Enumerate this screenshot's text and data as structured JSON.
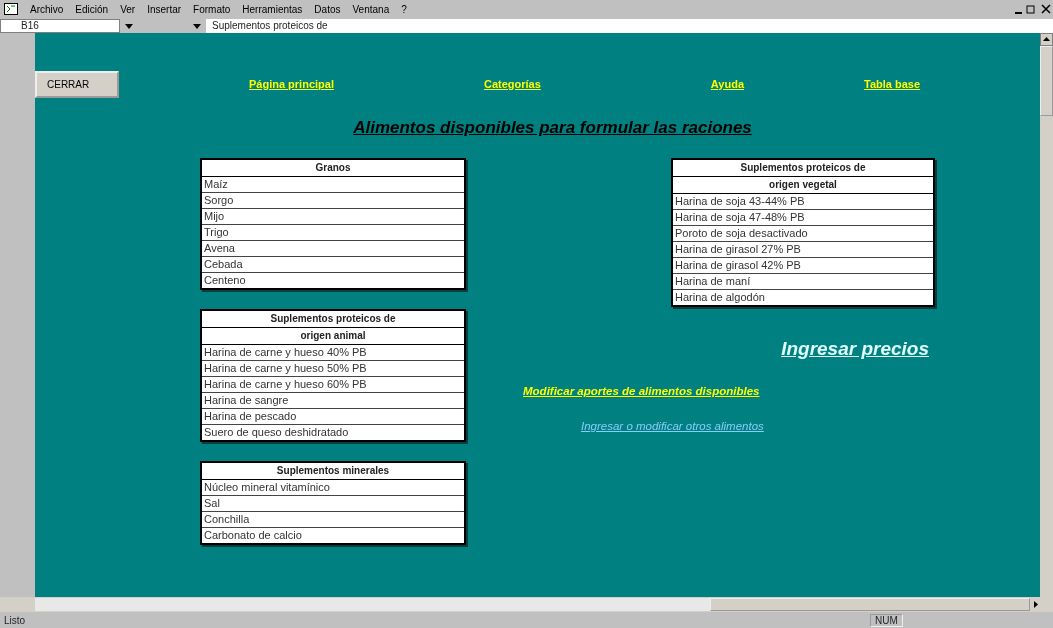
{
  "menu": [
    "Archivo",
    "Edición",
    "Ver",
    "Insertar",
    "Formato",
    "Herramientas",
    "Datos",
    "Ventana",
    "?"
  ],
  "name_box": "B16",
  "formula": "Suplementos proteicos de",
  "close_button": "CERRAR",
  "nav_links": [
    "Página principal",
    "Categorías",
    "Ayuda",
    "Tabla base"
  ],
  "title": "Alimentos disponibles para formular las raciones",
  "left_tables": [
    {
      "header": [
        "Granos"
      ],
      "rows": [
        "Maíz",
        "Sorgo",
        "Mijo",
        "Trigo",
        "Avena",
        "Cebada",
        "Centeno"
      ]
    },
    {
      "header": [
        "Suplementos proteicos de",
        "origen animal"
      ],
      "rows": [
        "Harina de carne y hueso 40% PB",
        "Harina de carne y hueso 50% PB",
        "Harina de carne y hueso 60% PB",
        "Harina de sangre",
        "Harina de pescado",
        "Suero de queso deshidratado"
      ]
    },
    {
      "header": [
        "Suplementos minerales"
      ],
      "rows": [
        "Núcleo mineral vitamínico",
        "Sal",
        "Conchilla",
        "Carbonato de calcio"
      ]
    }
  ],
  "right_tables": [
    {
      "header": [
        "Suplementos proteicos de",
        "origen vegetal"
      ],
      "rows": [
        "Harina de soja 43-44% PB",
        "Harina de soja 47-48% PB",
        "Poroto de soja desactivado",
        "Harina de girasol 27% PB",
        "Harina de girasol 42% PB",
        "Harina de maní",
        "Harina de algodón"
      ]
    }
  ],
  "links": [
    {
      "kind": "large",
      "text": "Ingresar precios"
    },
    {
      "kind": "yellow",
      "text": "Modificar aportes de alimentos disponibles"
    },
    {
      "kind": "blue",
      "text": "Ingresar o modificar otros alimentos"
    }
  ],
  "status_bar": {
    "message": "Listo",
    "indicator": "NUM"
  }
}
